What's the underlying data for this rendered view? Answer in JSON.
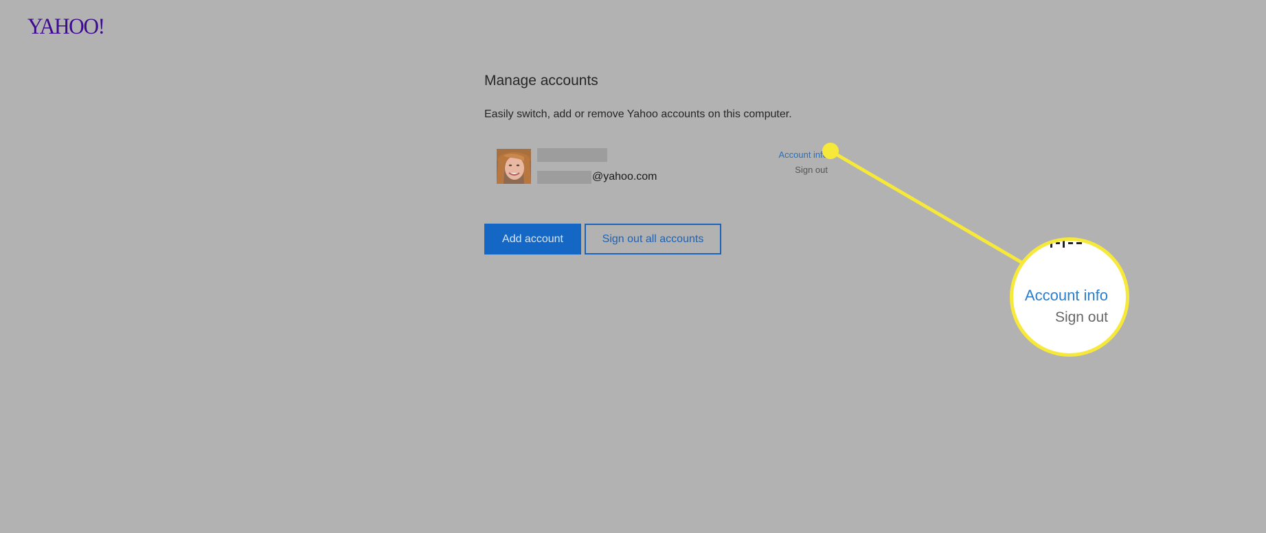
{
  "brand": {
    "logo_text": "YAHOO!",
    "logo_color": "#3d0a8f"
  },
  "header": {
    "title": "Manage accounts",
    "subtitle": "Easily switch, add or remove Yahoo accounts on this computer."
  },
  "account": {
    "email_suffix": "@yahoo.com",
    "account_info_label": "Account info",
    "sign_out_label": "Sign out"
  },
  "actions": {
    "add_account_label": "Add account",
    "sign_out_all_label": "Sign out all accounts"
  },
  "callout": {
    "account_info_label": "Account info",
    "sign_out_label": "Sign out",
    "highlight_color": "#f7e93a"
  },
  "colors": {
    "background": "#b2b2b2",
    "primary_button": "#1467c4",
    "link": "#2b6fb8"
  }
}
